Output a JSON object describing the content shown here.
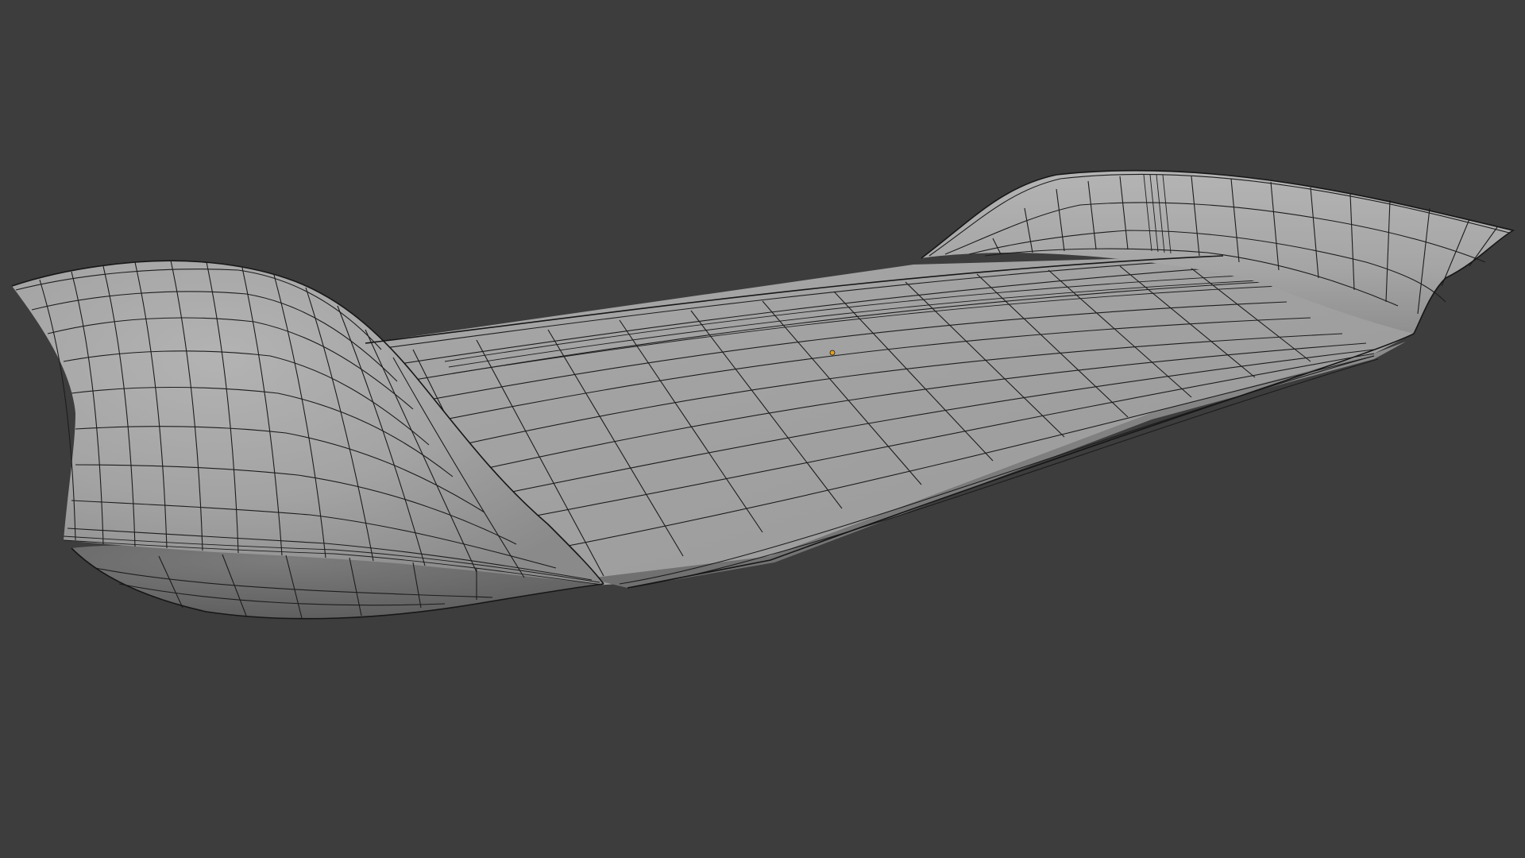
{
  "viewport": {
    "background_color": "#3d3d3d",
    "mesh_base_color": "#a2a2a2",
    "mesh_shadow_color": "#6e6e6e",
    "mesh_highlight_color": "#b7b7b7",
    "wire_color": "#1c1c1c",
    "origin_marker_color": "#e0a020"
  },
  "scene": {
    "object_icon": "mesh-object-icon",
    "origin_icon": "object-origin-icon"
  }
}
